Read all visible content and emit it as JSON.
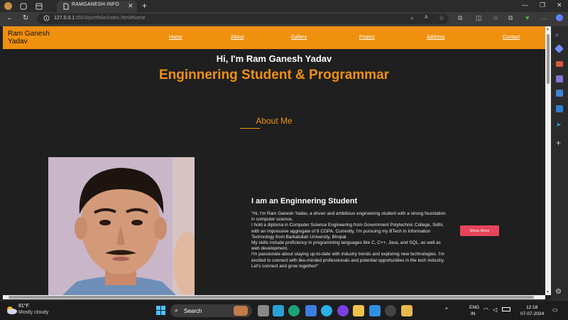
{
  "browser": {
    "tab_title": "RAMGANESH-INFO",
    "url_host": "127.0.0.1",
    "url_path": ":5503/portfolio/index.html#home"
  },
  "site": {
    "logo": "Ram Ganesh Yadav",
    "nav": [
      "Home",
      "About",
      "Gallery",
      "Project",
      "Address",
      "Contact"
    ],
    "hero_hello": "Hi, I'm Ram Ganesh Yadav",
    "hero_title": "Enginnering Student & Programmar",
    "about_heading": "About Me",
    "sub_heading": "I am an Enginnering Student",
    "about_paragraphs": [
      "\"Hi, I'm Ram Ganesh Yadav, a driven and ambitious engineering student with a strong foundation in computer science.",
      "I hold a diploma in Computer Science Engineering from Government Polytechnic College, Sidhi, with an impressive aggregate of 8 CGPA. Currently, I'm pursuing my BTech in Information Technology from Barkatullah University, Bhopal.",
      "My skills include proficiency in programming languages like C, C++, Java, and SQL, as well as web development.",
      "I'm passionate about staying up-to-date with industry trends and exploring new technologies. I'm excited to connect with like-minded professionals and potential opportunities in the tech industry. Let's connect and grow together!\""
    ],
    "show_more": "Show More"
  },
  "taskbar": {
    "weather_temp": "81°F",
    "weather_condition": "Mostly cloudy",
    "search": "Search",
    "lang_line1": "ENG",
    "lang_line2": "IN",
    "time": "12:18",
    "date": "07-07-2024"
  },
  "colors": {
    "accent": "#f0900f",
    "button": "#e8445a",
    "page_bg": "#1f1f1f"
  }
}
